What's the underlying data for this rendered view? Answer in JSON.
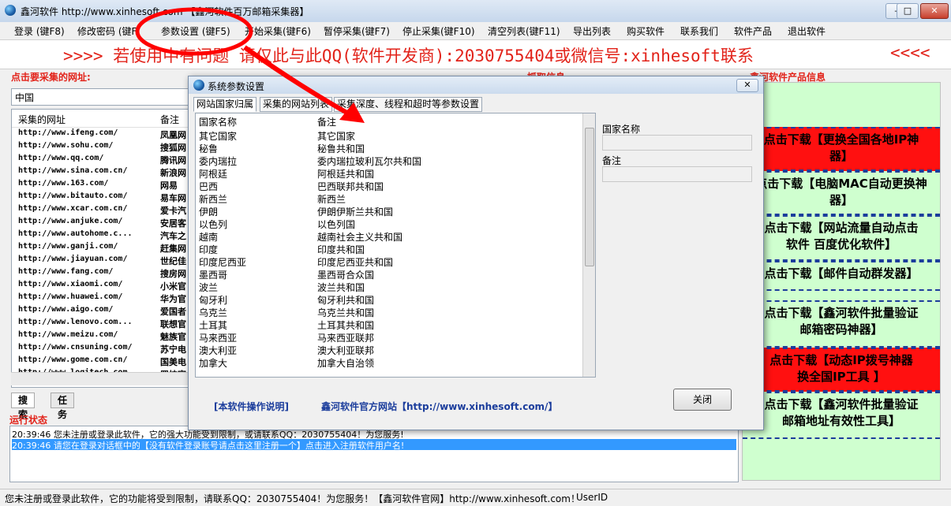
{
  "window": {
    "title": "鑫河软件 http://www.xinhesoft.com 【鑫河软件百万邮箱采集器】",
    "controls": [
      "minimize",
      "maximize",
      "close"
    ]
  },
  "menu": [
    "登录 (键F8)",
    "修改密码 (键F",
    "参数设置 (键F5)",
    "开始采集(键F6)",
    "暂停采集(键F7)",
    "停止采集(键F10)",
    "清空列表(键F11)",
    "导出列表",
    "购买软件",
    "联系我们",
    "软件产品",
    "退出软件"
  ],
  "banner": {
    "text": ">>>> 若使用中有问题 请仅此与此QQ(软件开发商):2030755404或微信号:xinhesoft联系",
    "arrows": "<<<<"
  },
  "left": {
    "heading": "点击要采集的网址:",
    "region": "中国",
    "columns": [
      "采集的网址",
      "备注"
    ],
    "rows": [
      {
        "url": "http://www.ifeng.com/",
        "note": "凤凰网"
      },
      {
        "url": "http://www.sohu.com/",
        "note": "搜狐网"
      },
      {
        "url": "http://www.qq.com/",
        "note": "腾讯网"
      },
      {
        "url": "http://www.sina.com.cn/",
        "note": "新浪网"
      },
      {
        "url": "http://www.163.com/",
        "note": "网易"
      },
      {
        "url": "http://www.bitauto.com/",
        "note": "易车网"
      },
      {
        "url": "http://www.xcar.com.cn/",
        "note": "爱卡汽"
      },
      {
        "url": "http://www.anjuke.com/",
        "note": "安居客"
      },
      {
        "url": "http://www.autohome.c...",
        "note": "汽车之"
      },
      {
        "url": "http://www.ganji.com/",
        "note": "赶集网"
      },
      {
        "url": "http://www.jiayuan.com/",
        "note": "世纪佳"
      },
      {
        "url": "http://www.fang.com/",
        "note": "搜房网"
      },
      {
        "url": "http://www.xiaomi.com/",
        "note": "小米官"
      },
      {
        "url": "http://www.huawei.com/",
        "note": "华为官"
      },
      {
        "url": "http://www.aigo.com/",
        "note": "爱国者"
      },
      {
        "url": "http://www.lenovo.com...",
        "note": "联想官"
      },
      {
        "url": "http://www.meizu.com/",
        "note": "魅族官"
      },
      {
        "url": "http://www.cnsuning.com/",
        "note": "苏宁电"
      },
      {
        "url": "http://www.gome.com.cn/",
        "note": "国美电"
      },
      {
        "url": "http://www.logitech.com...",
        "note": "罗技官"
      }
    ],
    "tabs": [
      "搜索",
      "任务"
    ]
  },
  "middle_heading": "抓取信息",
  "status_panel": {
    "heading": "运行状态",
    "lines": [
      "20:39:46  您未注册或登录此软件，它的强大功能受到限制，或请联系QQ：2030755404！为您服务!",
      "20:39:46  请您在登录对话框中的【没有软件登录账号请点击这里注册一个】点击进入注册软件用户名!"
    ]
  },
  "right_panel": {
    "heading": "鑫河软件产品信息",
    "ads": [
      {
        "text": "点击下载【更换全国各地IP神器】",
        "line1": "点击下载【更换全国各地IP神",
        "line2": "器】",
        "red": true
      },
      {
        "text": "点击下载【电脑MAC自动更换神器】",
        "line1": "点击下载【电脑MAC自动更换神",
        "line2": "器】",
        "red": false
      },
      {
        "text": "点击下载【网站流量自动点击软件 百度优化软件】",
        "line1": "点击下载【网站流量自动点击",
        "line2": "软件 百度优化软件】",
        "red": false
      },
      {
        "text": "点击下载【邮件自动群发器】",
        "line1": "点击下载【邮件自动群发器】",
        "line2": "",
        "red": false
      },
      {
        "text": "点击下载【鑫河软件批量验证邮箱密码神器】",
        "line1": "点击下载【鑫河软件批量验证",
        "line2": "邮箱密码神器】",
        "red": false
      },
      {
        "text": "点击下载【动态IP拨号神器 换全国IP工具】",
        "line1": "点击下载【动态IP拨号神器",
        "line2": "换全国IP工具 】",
        "red": true
      },
      {
        "text": "点击下载【鑫河软件批量验证邮箱地址有效性工具】",
        "line1": "点击下载【鑫河软件批量验证",
        "line2": "邮箱地址有效性工具】",
        "red": false
      }
    ]
  },
  "dialog": {
    "title": "系统参数设置",
    "close_glyph": "✕",
    "tabs": [
      "网站国家归属",
      "采集的网站列表",
      "采集深度、线程和超时等参数设置"
    ],
    "grid": {
      "columns": [
        "国家名称",
        "备注"
      ],
      "rows": [
        {
          "name": "其它国家",
          "note": "其它国家"
        },
        {
          "name": "秘鲁",
          "note": "秘鲁共和国"
        },
        {
          "name": "委内瑞拉",
          "note": "委内瑞拉玻利瓦尔共和国"
        },
        {
          "name": "阿根廷",
          "note": "阿根廷共和国"
        },
        {
          "name": "巴西",
          "note": "巴西联邦共和国"
        },
        {
          "name": "新西兰",
          "note": "新西兰"
        },
        {
          "name": "伊朗",
          "note": "伊朗伊斯兰共和国"
        },
        {
          "name": "以色列",
          "note": "以色列国"
        },
        {
          "name": "越南",
          "note": "越南社会主义共和国"
        },
        {
          "name": "印度",
          "note": "印度共和国"
        },
        {
          "name": "印度尼西亚",
          "note": "印度尼西亚共和国"
        },
        {
          "name": "墨西哥",
          "note": "墨西哥合众国"
        },
        {
          "name": "波兰",
          "note": "波兰共和国"
        },
        {
          "name": "匈牙利",
          "note": "匈牙利共和国"
        },
        {
          "name": "乌克兰",
          "note": "乌克兰共和国"
        },
        {
          "name": "土耳其",
          "note": "土耳其共和国"
        },
        {
          "name": "马来西亚",
          "note": "马来西亚联邦"
        },
        {
          "name": "澳大利亚",
          "note": "澳大利亚联邦"
        },
        {
          "name": "加拿大",
          "note": "加拿大自治领"
        }
      ]
    },
    "fields": {
      "name_label": "国家名称",
      "name_value": "",
      "note_label": "备注",
      "note_value": ""
    },
    "links": {
      "manual": "[本软件操作说明]",
      "site": "鑫河软件官方网站【http://www.xinhesoft.com/】"
    },
    "close_button": "关闭"
  },
  "statusbar": {
    "text": "您未注册或登录此软件，它的功能将受到限制，请联系QQ：2030755404！为您服务！【鑫河软件官网】http://www.xinhesoft.com！",
    "userid": "UserID"
  },
  "colors": {
    "accent_red": "#e2231a",
    "link_blue": "#1b3d9c",
    "ad_green": "#cfffcf",
    "ad_red": "#ff1010",
    "annotation_red": "#ff0000"
  },
  "icons": [
    "app-globe-icon",
    "minimize-icon",
    "maximize-icon",
    "close-icon",
    "dialog-globe-icon",
    "annotation-arrow"
  ]
}
